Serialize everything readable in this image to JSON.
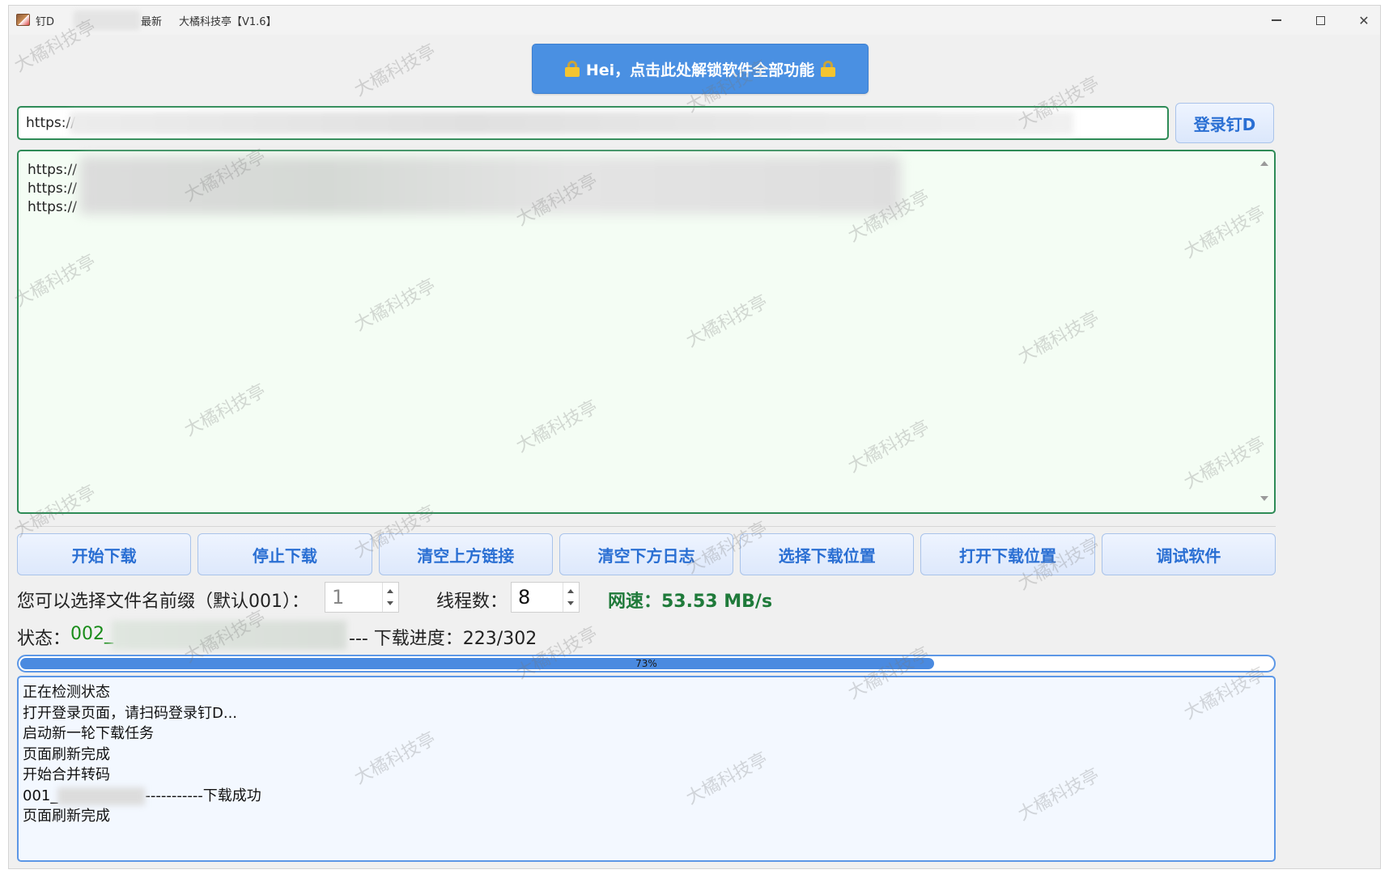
{
  "window": {
    "app_name": "钉D",
    "title_tag": "最新",
    "title_sub": "大橘科技亭【V1.6】"
  },
  "banner": {
    "text": "Hei，点击此处解锁软件全部功能"
  },
  "url_input": {
    "value": "https://"
  },
  "login_button": "登录钉D",
  "links": [
    "https://",
    "https://",
    "https://"
  ],
  "actions": [
    {
      "id": "start",
      "label": "开始下载"
    },
    {
      "id": "stop",
      "label": "停止下载"
    },
    {
      "id": "clear-links",
      "label": "清空上方链接"
    },
    {
      "id": "clear-log",
      "label": "清空下方日志"
    },
    {
      "id": "choose-location",
      "label": "选择下载位置"
    },
    {
      "id": "open-location",
      "label": "打开下载位置"
    },
    {
      "id": "debug",
      "label": "调试软件"
    }
  ],
  "options": {
    "prefix_label": "您可以选择文件名前缀（默认001）：",
    "prefix_value": "1",
    "threads_label": "线程数：",
    "threads_value": "8",
    "speed": "网速：53.53 MB/s"
  },
  "status": {
    "label": "状态：",
    "value": "002_",
    "progress_text": "--- 下载进度：223/302"
  },
  "progress": {
    "fraction": 0.73,
    "label": "73%"
  },
  "log": [
    {
      "text": "正在检测状态"
    },
    {
      "text": "打开登录页面，请扫码登录钉D..."
    },
    {
      "text": "启动新一轮下载任务"
    },
    {
      "text": "页面刷新完成"
    },
    {
      "text": "开始合并转码"
    },
    {
      "prefix": "001_",
      "suffix": "-----------下载成功"
    },
    {
      "text": "页面刷新完成"
    }
  ],
  "watermark": "大橘科技亭",
  "colors": {
    "accent_blue": "#4a90e2",
    "green_border": "#2e8b57",
    "speed_green": "#1f7a3a",
    "status_green": "#1a8c1a",
    "progress_blue": "#4a8ae0"
  }
}
